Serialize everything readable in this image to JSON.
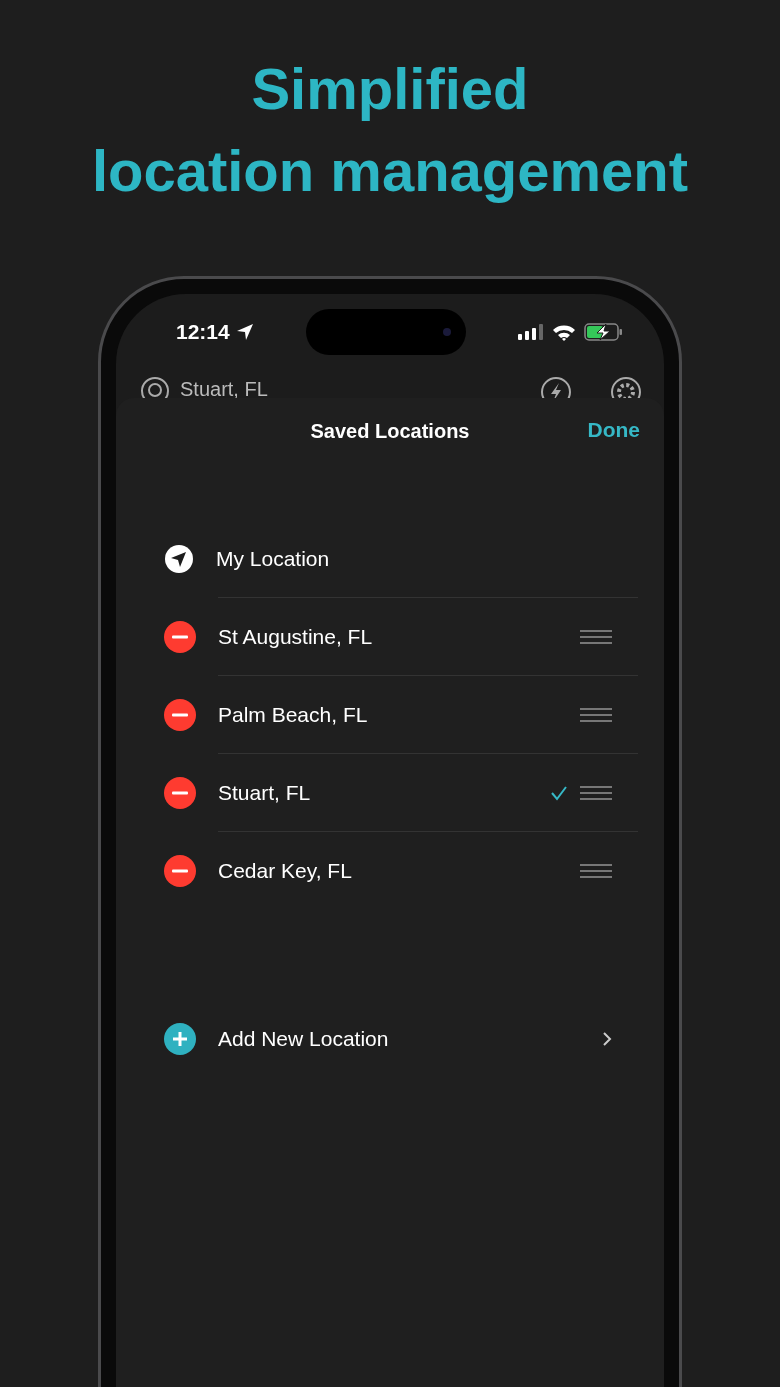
{
  "headline": [
    "Simplified",
    "location management"
  ],
  "status_bar": {
    "time": "12:14"
  },
  "search": {
    "value": "Stuart, FL"
  },
  "sheet": {
    "title": "Saved Locations",
    "done": "Done"
  },
  "locations": [
    {
      "name": "My Location",
      "kind": "current",
      "selected": false
    },
    {
      "name": "St Augustine, FL",
      "kind": "saved",
      "selected": false
    },
    {
      "name": "Palm Beach, FL",
      "kind": "saved",
      "selected": false
    },
    {
      "name": "Stuart, FL",
      "kind": "saved",
      "selected": true
    },
    {
      "name": "Cedar Key, FL",
      "kind": "saved",
      "selected": false
    }
  ],
  "add_button": {
    "label": "Add New Location"
  }
}
